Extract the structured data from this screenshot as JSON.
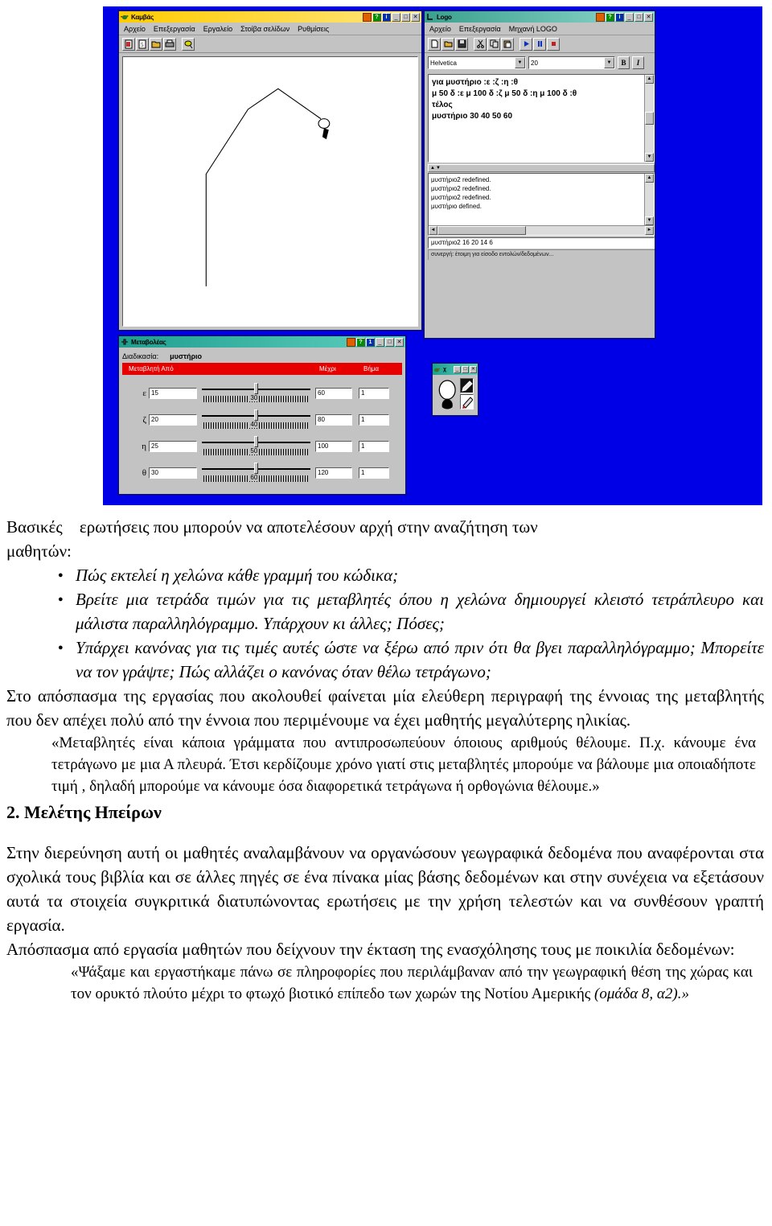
{
  "desktop": {
    "background_color": "#0000e6"
  },
  "canvas_window": {
    "title": "Καμβάς",
    "title_icon": "turtle-icon",
    "menu": [
      "Αρχείο",
      "Επεξεργασία",
      "Εργαλείο",
      "Στοίβα σελίδων",
      "Ρυθμίσεις"
    ],
    "toolbar_icons": [
      "new-page-icon",
      "copy-page-icon",
      "open-folder-icon",
      "print-icon",
      "paint-icon"
    ],
    "window_buttons": [
      "square-button",
      "?",
      "i",
      "_",
      "□",
      "✕"
    ]
  },
  "logo_window": {
    "title": "Logo",
    "title_icon": "logo-icon",
    "menu": [
      "Αρχείο",
      "Επεξεργασία",
      "Μηχανή LOGO"
    ],
    "toolbar_icons": [
      "new-file-icon",
      "open-folder-icon",
      "save-icon",
      "cut-icon",
      "copy-icon",
      "paste-icon",
      "run-icon",
      "pause-icon",
      "stop-icon"
    ],
    "font_name": "Helvetica",
    "font_size": "20",
    "bold_label": "B",
    "italic_label": "I",
    "code": "για μυστήριο :ε :ζ :η :θ\nμ 50 δ :ε μ 100 δ :ζ μ 50 δ :η μ 100 δ :θ\nτέλος\nμυστήριο 30 40 50 60",
    "console": "μυστήριο2 redefined.\nμυστήριο2 redefined.\nμυστήριο2 redefined.\nμυστήριο defined.",
    "input_value": "μυστήριο2 16 20 14 6",
    "status": "συνεργή: έτοιμη για είσοδο εντολών/δεδομένων...",
    "window_buttons": [
      "square-button",
      "?",
      "i",
      "_",
      "□",
      "✕"
    ]
  },
  "variables_window": {
    "title": "Μεταβολέας",
    "title_icon": "slider-icon",
    "procedure_label": "Διαδικασία:",
    "procedure_name": "μυστήριο",
    "columns": [
      "Μεταβλητή Από",
      "Μέχρι",
      "Βήμα"
    ],
    "rows": [
      {
        "name": "ε",
        "from": "15",
        "current": "30",
        "to": "60",
        "step": "1"
      },
      {
        "name": "ζ",
        "from": "20",
        "current": "40",
        "to": "80",
        "step": "1"
      },
      {
        "name": "η",
        "from": "25",
        "current": "50",
        "to": "100",
        "step": "1"
      },
      {
        "name": "θ",
        "from": "30",
        "current": "60",
        "to": "120",
        "step": "1"
      }
    ],
    "window_buttons": [
      "square-button",
      "?",
      "1",
      "_",
      "□",
      "✕"
    ]
  },
  "turtle_window": {
    "title": "χ",
    "title_icon": "turtle-icon",
    "window_buttons": [
      "_",
      "□",
      "✕"
    ],
    "tools": [
      "pen-icon",
      "eraser-icon"
    ]
  },
  "document": {
    "intro_lead": "Βασικές",
    "intro_lead2": "μαθητών:",
    "intro_rest": "ερωτήσεις που μπορούν να αποτελέσουν αρχή στην αναζήτηση των",
    "bullets": [
      "Πώς εκτελεί η χελώνα κάθε γραμμή του κώδικα;",
      "Βρείτε μια τετράδα τιμών για τις μεταβλητές όπου η χελώνα δημιουργεί κλειστό τετράπλευρο και μάλιστα παραλληλόγραμμο. Υπάρχουν κι άλλες; Πόσες;",
      "Υπάρχει κανόνας για τις τιμές αυτές ώστε να ξέρω από πριν ότι θα βγει παραλληλόγραμμο; Μπορείτε να τον γράψτε; Πώς αλλάζει ο κανόνας όταν θέλω τετράγωνο;"
    ],
    "para1": "Στο απόσπασμα της εργασίας που ακολουθεί φαίνεται μία ελεύθερη περιγραφή της έννοιας της μεταβλητής που δεν απέχει πολύ από την έννοια που περιμένουμε να έχει μαθητής μεγαλύτερης ηλικίας.",
    "quote1": "«Μεταβλητές είναι κάποια γράμματα που αντιπροσωπεύουν όποιους αριθμούς θέλουμε. Π.χ. κάνουμε ένα τετράγωνο με μια Α πλευρά. Έτσι κερδίζουμε χρόνο γιατί στις μεταβλητές μπορούμε να βάλουμε μια οποιαδήποτε τιμή , δηλαδή μπορούμε να κάνουμε όσα διαφορετικά τετράγωνα ή ορθογώνια θέλουμε.»",
    "heading2": "2. Μελέτης Ηπείρων",
    "para2": "Στην διερεύνηση αυτή οι μαθητές αναλαμβάνουν να οργανώσουν γεωγραφικά δεδομένα που αναφέρονται στα σχολικά τους βιβλία και σε άλλες πηγές σε ένα πίνακα μίας βάσης δεδομένων και στην συνέχεια να εξετάσουν αυτά τα στοιχεία συγκριτικά διατυπώνοντας ερωτήσεις με την χρήση τελεστών και να συνθέσουν γραπτή εργασία.",
    "para3": "Απόσπασμα από εργασία μαθητών που δείχνουν την έκταση της ενασχόλησης τους με ποικιλία δεδομένων:",
    "quote2_main": "«Ψάξαμε και εργαστήκαμε πάνω σε πληροφορίες που περιλάμβαναν από την γεωγραφική θέση της χώρας και τον ορυκτό πλούτο μέχρι το φτωχό βιοτικό επίπεδο των χωρών της Νοτίου Αμερικής ",
    "quote2_ital": "(ομάδα 8, α2).»"
  }
}
